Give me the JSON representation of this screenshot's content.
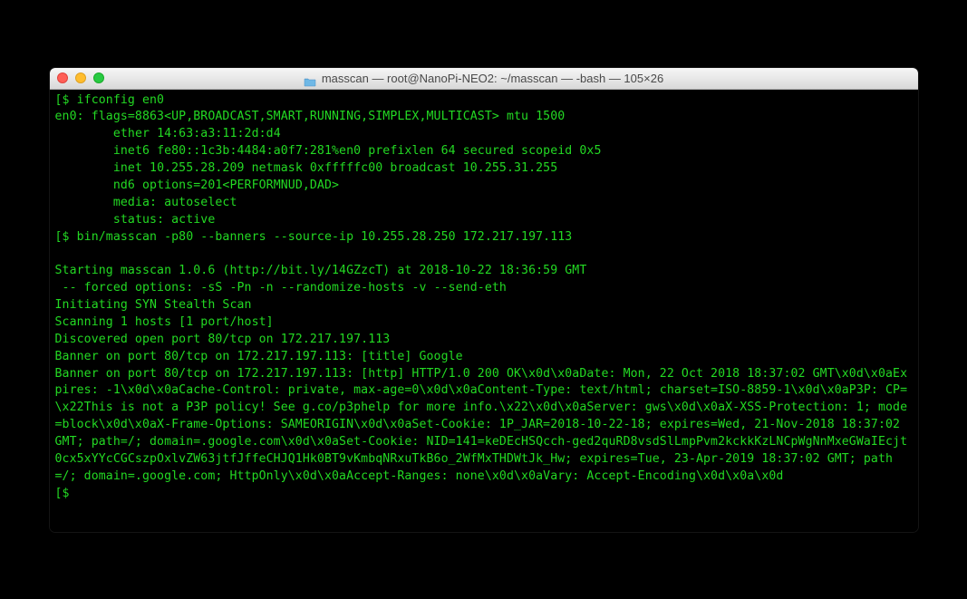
{
  "titlebar": {
    "title": "masscan — root@NanoPi-NEO2: ~/masscan — -bash — 105×26"
  },
  "terminal": {
    "prompt1": "$ ifconfig en0",
    "ifconfig": {
      "l1": "en0: flags=8863<UP,BROADCAST,SMART,RUNNING,SIMPLEX,MULTICAST> mtu 1500",
      "l2": "        ether 14:63:a3:11:2d:d4",
      "l3": "        inet6 fe80::1c3b:4484:a0f7:281%en0 prefixlen 64 secured scopeid 0x5",
      "l4": "        inet 10.255.28.209 netmask 0xfffffc00 broadcast 10.255.31.255",
      "l5": "        nd6 options=201<PERFORMNUD,DAD>",
      "l6": "        media: autoselect",
      "l7": "        status: active"
    },
    "prompt2": "$ bin/masscan -p80 --banners --source-ip 10.255.28.250 172.217.197.113",
    "blank1": " ",
    "masscan": {
      "l1": "Starting masscan 1.0.6 (http://bit.ly/14GZzcT) at 2018-10-22 18:36:59 GMT",
      "l2": " -- forced options: -sS -Pn -n --randomize-hosts -v --send-eth",
      "l3": "Initiating SYN Stealth Scan",
      "l4": "Scanning 1 hosts [1 port/host]",
      "l5": "Discovered open port 80/tcp on 172.217.197.113",
      "l6": "Banner on port 80/tcp on 172.217.197.113: [title] Google",
      "l7": "Banner on port 80/tcp on 172.217.197.113: [http] HTTP/1.0 200 OK\\x0d\\x0aDate: Mon, 22 Oct 2018 18:37:02 GMT\\x0d\\x0aExpires: -1\\x0d\\x0aCache-Control: private, max-age=0\\x0d\\x0aContent-Type: text/html; charset=ISO-8859-1\\x0d\\x0aP3P: CP=\\x22This is not a P3P policy! See g.co/p3phelp for more info.\\x22\\x0d\\x0aServer: gws\\x0d\\x0aX-XSS-Protection: 1; mode=block\\x0d\\x0aX-Frame-Options: SAMEORIGIN\\x0d\\x0aSet-Cookie: 1P_JAR=2018-10-22-18; expires=Wed, 21-Nov-2018 18:37:02 GMT; path=/; domain=.google.com\\x0d\\x0aSet-Cookie: NID=141=keDEcHSQcch-ged2quRD8vsdSlLmpPvm2kckkKzLNCpWgNnMxeGWaIEcjt0cx5xYYcCGCszpOxlvZW63jtfJffeCHJQ1Hk0BT9vKmbqNRxuTkB6o_2WfMxTHDWtJk_Hw; expires=Tue, 23-Apr-2019 18:37:02 GMT; path=/; domain=.google.com; HttpOnly\\x0d\\x0aAccept-Ranges: none\\x0d\\x0aVary: Accept-Encoding\\x0d\\x0a\\x0d"
    },
    "prompt3": "$ "
  }
}
